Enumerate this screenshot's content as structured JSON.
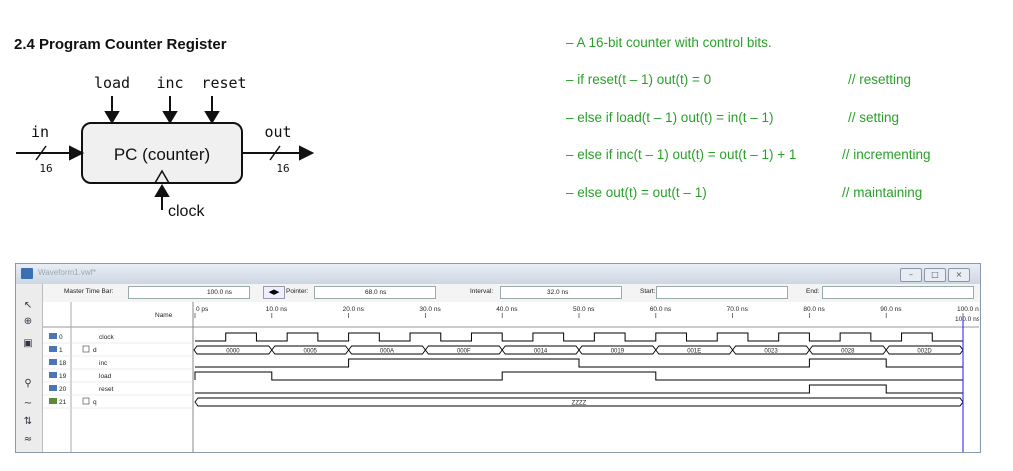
{
  "section_title": "2.4 Program Counter Register",
  "diagram": {
    "block_label": "PC (counter)",
    "inputs_top": [
      "load",
      "inc",
      "reset"
    ],
    "in_label": "in",
    "out_label": "out",
    "in_width": "16",
    "out_width": "16",
    "clock_label": "clock"
  },
  "description": {
    "lines": [
      {
        "text": "– A 16-bit counter with control bits.",
        "comment": ""
      },
      {
        "text": "– if reset(t – 1) out(t) = 0",
        "comment": "// resetting"
      },
      {
        "text": "– else if load(t – 1) out(t) = in(t – 1)",
        "comment": "// setting"
      },
      {
        "text": "– else if inc(t – 1) out(t) = out(t – 1) + 1",
        "comment": "// incrementing"
      },
      {
        "text": "– else out(t) = out(t – 1)",
        "comment": "// maintaining"
      }
    ]
  },
  "waveform": {
    "window_title": "Waveform1.vwf*",
    "master_label": "Master Time Bar:",
    "master_value": "100.0 ns",
    "pointer_label": "Pointer:",
    "pointer_value": "68.0 ns",
    "interval_label": "Interval:",
    "interval_value": "32.0 ns",
    "start_label": "Start:",
    "end_label": "End:",
    "name_header": "Name",
    "time_ticks": [
      "0 ps",
      "10.0 ns",
      "20.0 ns",
      "30.0 ns",
      "40.0 ns",
      "50.0 ns",
      "60.0 ns",
      "70.0 ns",
      "80.0 ns",
      "90.0 ns",
      "100.0 ns"
    ],
    "cursor_label": "100.0 ns",
    "signals": [
      {
        "index": "0",
        "name": "clock"
      },
      {
        "index": "1",
        "name": "d"
      },
      {
        "index": "18",
        "name": "inc"
      },
      {
        "index": "19",
        "name": "load"
      },
      {
        "index": "20",
        "name": "reset"
      },
      {
        "index": "21",
        "name": "q"
      }
    ],
    "d_values": [
      "0000",
      "0005",
      "000A",
      "000F",
      "0014",
      "0019",
      "001E",
      "0023",
      "0028",
      "002D"
    ],
    "q_value": "ZZZZ",
    "clock_edges": [
      4,
      8,
      12,
      16,
      20,
      24,
      28,
      32,
      36,
      40,
      44,
      48,
      52,
      56,
      60,
      64,
      68,
      72,
      76,
      80,
      84,
      88,
      92,
      96
    ],
    "inc_high": [
      [
        20,
        50
      ],
      [
        80,
        90
      ]
    ],
    "load_high": [
      [
        0,
        10
      ],
      [
        40,
        60
      ]
    ],
    "reset_high": [
      [
        80,
        90
      ]
    ],
    "colors": {
      "accent_green": "#2aa02a",
      "wave": "#000000",
      "cursor": "#1a1aff"
    }
  }
}
